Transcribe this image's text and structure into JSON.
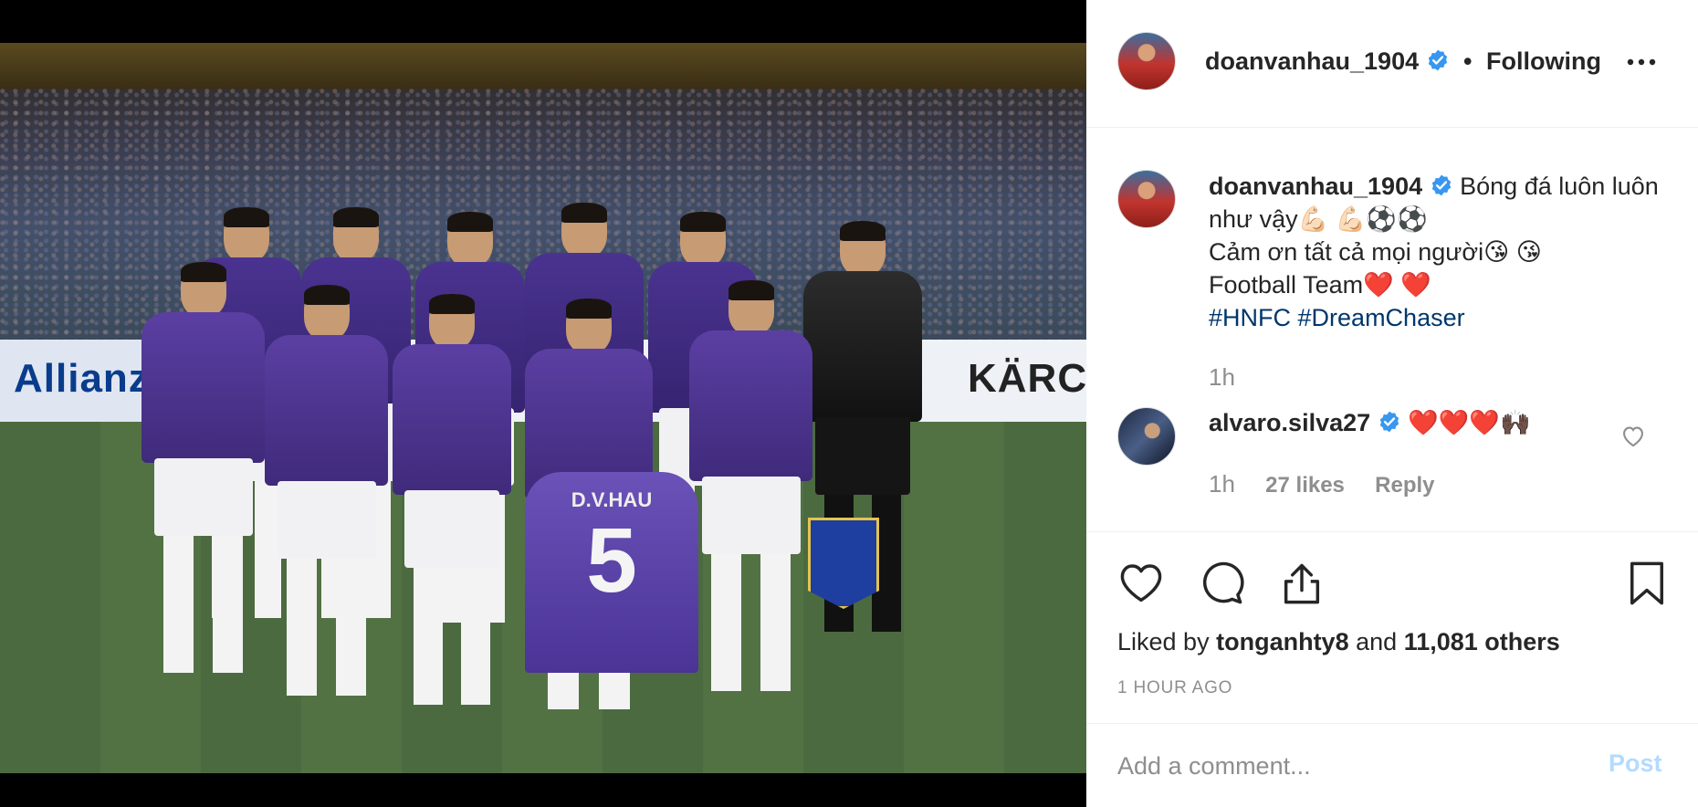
{
  "photo": {
    "description_icon": "photo",
    "ad_left": "Allianz",
    "ad_right": "KÄRCH",
    "held_jersey_name": "D.V.HAU",
    "held_jersey_number": "5"
  },
  "header": {
    "username": "doanvanhau_1904",
    "verified_icon": "verified-badge-icon",
    "separator": "•",
    "follow_label": "Following",
    "more_icon": "more-options-icon"
  },
  "caption": {
    "username": "doanvanhau_1904",
    "line1": "Bóng đá luôn luôn như vậy",
    "line1_emoji": "💪🏻 💪🏻⚽️⚽️",
    "line2": "Cảm ơn tất cả mọi người",
    "line2_emoji": "😘 😘",
    "line3": "Football Team",
    "line3_emoji": "❤️ ❤️",
    "hashtag1": "#HNFC",
    "hashtag2": "#DreamChaser",
    "time": "1h"
  },
  "comment": {
    "username": "alvaro.silva27",
    "text": "❤️❤️❤️🙌🏿",
    "time": "1h",
    "likes": "27 likes",
    "reply": "Reply"
  },
  "actions": {
    "liked_by_prefix": "Liked by",
    "liked_by_user": "tonganhty8",
    "and": "and",
    "others": "11,081 others",
    "post_time": "1 HOUR AGO"
  },
  "add_comment": {
    "placeholder": "Add a comment...",
    "post_label": "Post"
  },
  "colors": {
    "verified_blue": "#3897f0",
    "hashtag_blue": "#00376b",
    "post_disabled": "#b3dbff",
    "secondary_text": "#8e8e8e"
  }
}
